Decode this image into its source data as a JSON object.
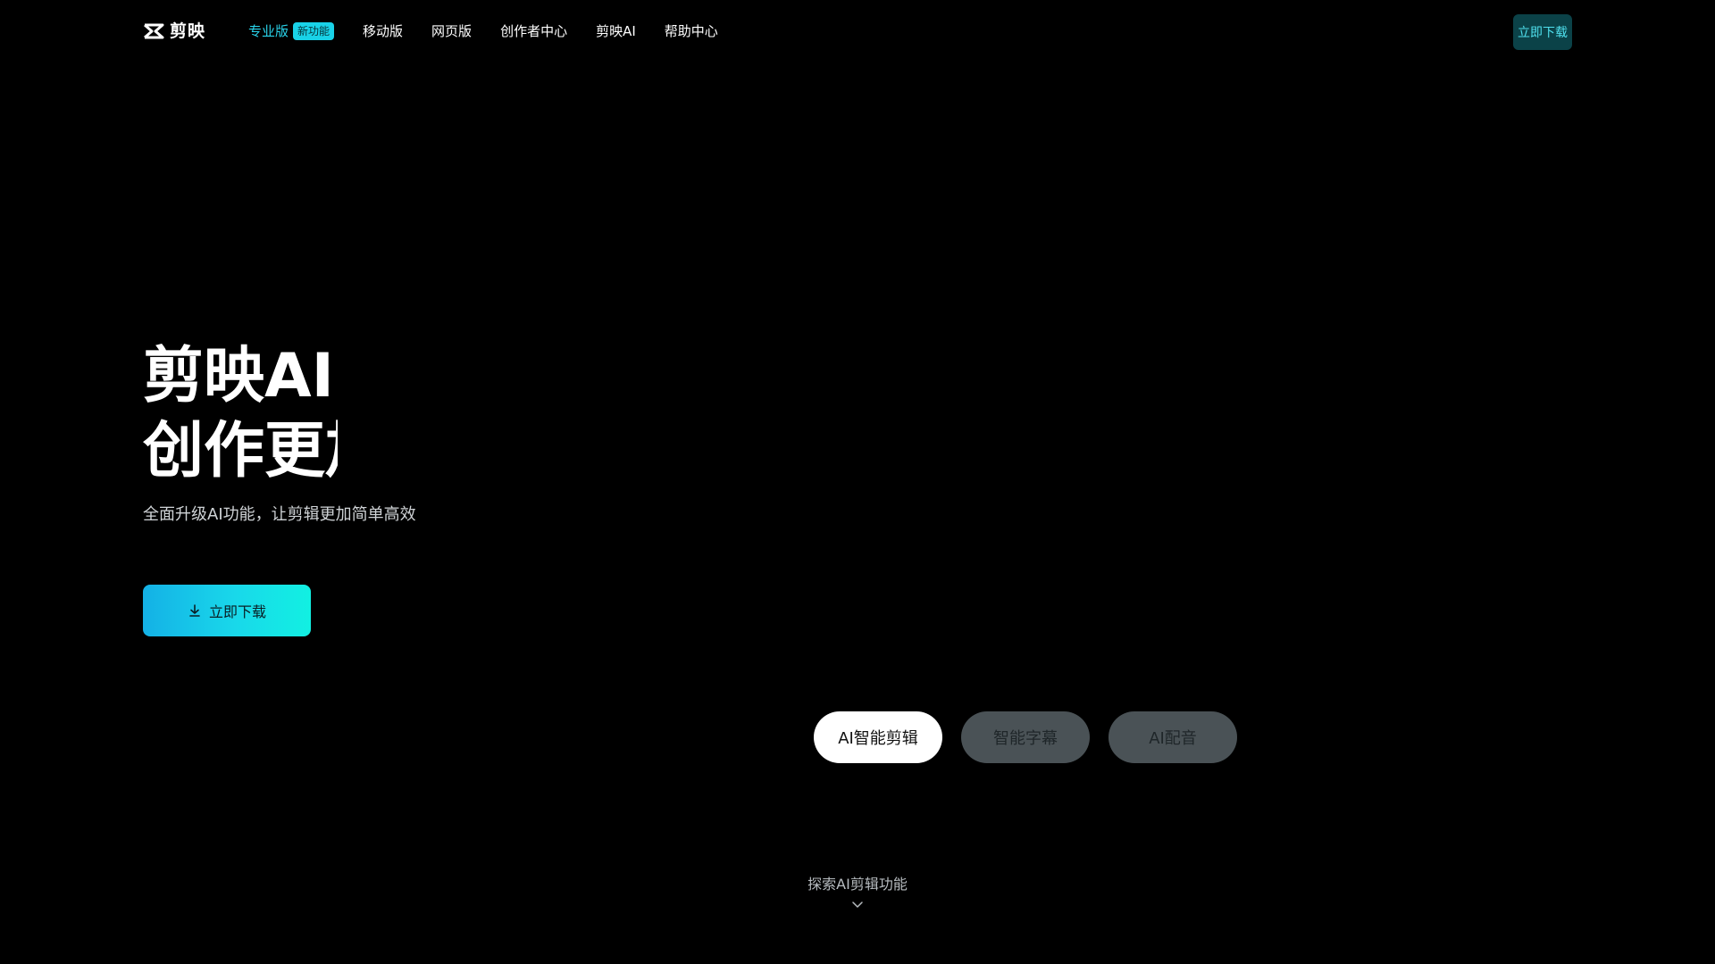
{
  "brand": {
    "name": "剪映",
    "logo_icon": "capcut-logo-icon"
  },
  "nav": {
    "items": [
      {
        "label": "专业版",
        "badge": "新功能",
        "active": true
      },
      {
        "label": "移动版",
        "active": false
      },
      {
        "label": "网页版",
        "active": false
      },
      {
        "label": "创作者中心",
        "active": false
      },
      {
        "label": "剪映AI",
        "active": false
      },
      {
        "label": "帮助中心",
        "active": false
      }
    ]
  },
  "header": {
    "download_label": "立即下载"
  },
  "hero": {
    "title_line1": "剪映AI",
    "title_line2": "创作更加简单",
    "subtitle": "全面升级AI功能，让剪辑更加简单高效",
    "download_label": "立即下载",
    "download_icon": "download-icon"
  },
  "features": {
    "tabs": [
      {
        "label": "AI智能剪辑",
        "selected": true
      },
      {
        "label": "智能字幕",
        "selected": false
      },
      {
        "label": "AI配音",
        "selected": false
      }
    ]
  },
  "scroll_hint": {
    "label": "探索AI剪辑功能",
    "icon": "chevron-down-icon"
  },
  "colors": {
    "background": "#000000",
    "accent": "#19d2e8",
    "nav_active": "#29d3ea",
    "header_button_bg": "#0b4248",
    "pill_inactive": "#4a5256"
  }
}
